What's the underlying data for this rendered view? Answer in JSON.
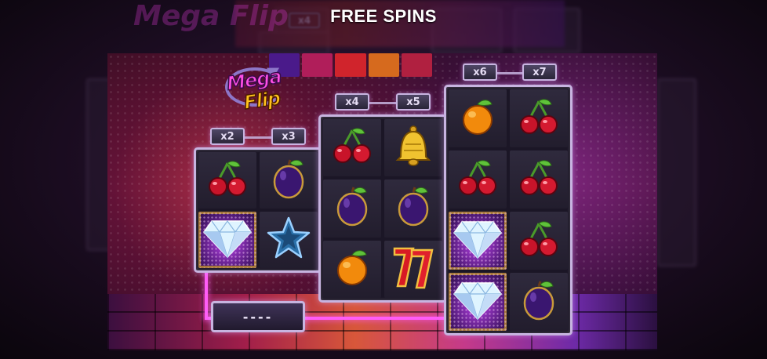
{
  "header": {
    "title": "FREE SPINS"
  },
  "background": {
    "logo_text": "Mega Flip",
    "multiplier": "x4"
  },
  "logo": {
    "line1": "Mega",
    "line2": "Flip"
  },
  "blocks": [
    {
      "multipliers": [
        "x2",
        "x3"
      ],
      "rows": [
        [
          "cherry",
          "plum"
        ],
        [
          "diamond",
          "star"
        ]
      ]
    },
    {
      "multipliers": [
        "x4",
        "x5"
      ],
      "rows": [
        [
          "cherry",
          "bell"
        ],
        [
          "plum",
          "plum"
        ],
        [
          "orange",
          "seven"
        ]
      ]
    },
    {
      "multipliers": [
        "x6",
        "x7"
      ],
      "rows": [
        [
          "orange",
          "cherry"
        ],
        [
          "cherry",
          "cherry"
        ],
        [
          "diamond",
          "cherry"
        ],
        [
          "diamond",
          "plum"
        ]
      ]
    }
  ],
  "win_display": {
    "value": "----"
  },
  "colors": {
    "neon": "#ff5cf7",
    "frame": "#c7b4e0",
    "logo_pink": "#ff4fe4",
    "logo_gold": "#ffc21c"
  }
}
